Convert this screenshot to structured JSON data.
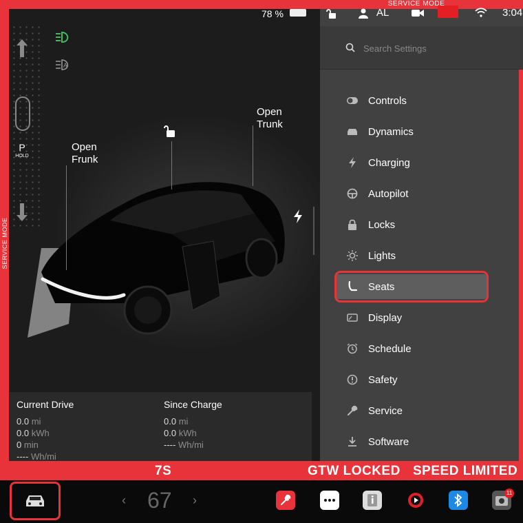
{
  "service_mode": {
    "banner_top": "SERVICE MODE",
    "banner_left": "SERVICE MODE",
    "frame_color": "#e8333a"
  },
  "status_bar": {
    "battery_percent": "78 %",
    "battery_level": 0.78,
    "profile_name": "AL",
    "clock": "3:04"
  },
  "drive_panel": {
    "gear": "P",
    "gear_sub": "HOLD",
    "callouts": {
      "frunk_line1": "Open",
      "frunk_line2": "Frunk",
      "trunk_line1": "Open",
      "trunk_line2": "Trunk"
    }
  },
  "stats": {
    "current_drive": {
      "title": "Current Drive",
      "distance_value": "0.0",
      "distance_unit": "mi",
      "energy_value": "0.0",
      "energy_unit": "kWh",
      "time_value": "0",
      "time_unit": "min",
      "efficiency_value": "----",
      "efficiency_unit": "Wh/mi"
    },
    "since_charge": {
      "title": "Since Charge",
      "distance_value": "0.0",
      "distance_unit": "mi",
      "energy_value": "0.0",
      "energy_unit": "kWh",
      "efficiency_value": "----",
      "efficiency_unit": "Wh/mi"
    }
  },
  "settings": {
    "search_placeholder": "Search Settings",
    "items": [
      {
        "label": "Controls",
        "icon": "toggle-icon"
      },
      {
        "label": "Dynamics",
        "icon": "car-icon"
      },
      {
        "label": "Charging",
        "icon": "bolt-icon"
      },
      {
        "label": "Autopilot",
        "icon": "steering-wheel-icon"
      },
      {
        "label": "Locks",
        "icon": "lock-icon"
      },
      {
        "label": "Lights",
        "icon": "sun-icon"
      },
      {
        "label": "Seats",
        "icon": "seat-icon"
      },
      {
        "label": "Display",
        "icon": "display-icon"
      },
      {
        "label": "Schedule",
        "icon": "clock-icon"
      },
      {
        "label": "Safety",
        "icon": "alert-icon"
      },
      {
        "label": "Service",
        "icon": "wrench-icon"
      },
      {
        "label": "Software",
        "icon": "download-icon"
      }
    ],
    "selected": "Seats"
  },
  "bottom_status": {
    "left": "7S",
    "gateway": "GTW LOCKED",
    "speed": "SPEED LIMITED"
  },
  "dock": {
    "temperature": "67",
    "left_chevron": "‹",
    "right_chevron": "›",
    "camera_badge": "11",
    "app_colors": {
      "service": "#e8333a",
      "bluetooth": "#1e88e5",
      "media": "#e31e24"
    }
  }
}
